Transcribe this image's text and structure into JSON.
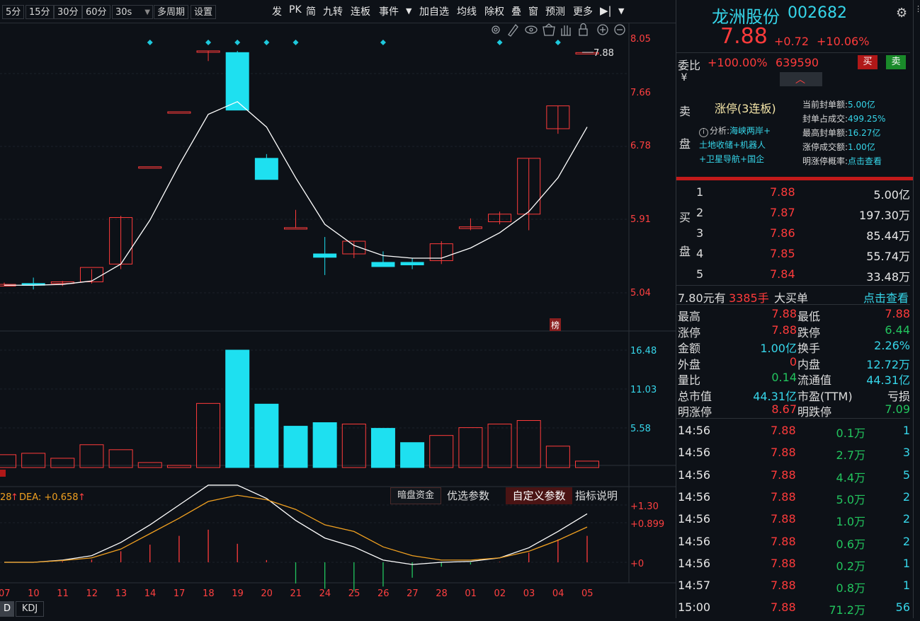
{
  "toolbar": {
    "periods": [
      "5分",
      "15分",
      "30分",
      "60分",
      "30s"
    ],
    "multi_period": "多周期",
    "settings": "设置",
    "right_items": [
      "发",
      "PK",
      "简",
      "九转",
      "连板",
      "事件",
      "加自选",
      "均线",
      "除权",
      "叠",
      "窗",
      "预测",
      "更多"
    ]
  },
  "chart": {
    "price_labels": [
      "8.05",
      "7.66",
      "6.78",
      "5.91",
      "5.04"
    ],
    "last_price_tag": "7.88",
    "bang_label": "榜",
    "volume_labels": [
      "16.48",
      "11.03",
      "5.58"
    ],
    "macd_labels": [
      "+1.30",
      "+0.899",
      "+0"
    ],
    "macd_header_left": "28",
    "macd_dea": "DEA: +0.658",
    "macd_buttons": [
      "暗盘资金",
      "优选参数",
      "自定义参数",
      "指标说明"
    ],
    "indicator_tabs": [
      "D",
      "KDJ"
    ]
  },
  "chart_data": {
    "type": "candlestick",
    "x": [
      "07",
      "10",
      "11",
      "12",
      "13",
      "14",
      "17",
      "18",
      "19",
      "20",
      "21",
      "24",
      "25",
      "26",
      "27",
      "28",
      "01",
      "02",
      "03",
      "04",
      "05"
    ],
    "ohlc": [
      [
        5.12,
        5.16,
        5.12,
        5.14
      ],
      [
        5.15,
        5.22,
        5.08,
        5.13
      ],
      [
        5.15,
        5.18,
        5.12,
        5.17
      ],
      [
        5.17,
        5.32,
        5.15,
        5.34
      ],
      [
        5.38,
        5.95,
        5.32,
        5.93
      ],
      [
        6.53,
        6.53,
        6.53,
        6.53
      ],
      [
        7.18,
        7.18,
        7.18,
        7.18
      ],
      [
        7.9,
        7.9,
        7.78,
        7.9
      ],
      [
        7.88,
        7.9,
        7.2,
        7.2
      ],
      [
        6.63,
        6.68,
        6.38,
        6.38
      ],
      [
        5.81,
        6.02,
        5.81,
        5.81
      ],
      [
        5.5,
        5.7,
        5.25,
        5.46
      ],
      [
        5.5,
        5.65,
        5.45,
        5.65
      ],
      [
        5.4,
        5.53,
        5.35,
        5.35
      ],
      [
        5.4,
        5.45,
        5.32,
        5.37
      ],
      [
        5.42,
        5.65,
        5.38,
        5.62
      ],
      [
        5.8,
        5.92,
        5.78,
        5.82
      ],
      [
        5.88,
        6.0,
        5.85,
        5.97
      ],
      [
        5.97,
        6.63,
        5.78,
        6.63
      ],
      [
        6.98,
        7.25,
        6.92,
        7.25
      ],
      [
        7.88,
        7.88,
        7.88,
        7.88
      ]
    ],
    "up_colors": {
      "up": "#ff3b3b",
      "down": "#1ee0f0"
    },
    "ma": [
      5.13,
      5.13,
      5.14,
      5.18,
      5.38,
      5.9,
      6.55,
      7.15,
      7.3,
      7.0,
      6.4,
      5.85,
      5.6,
      5.48,
      5.45,
      5.45,
      5.57,
      5.75,
      6.0,
      6.4,
      7.0
    ],
    "volume": [
      1.8,
      2.0,
      1.3,
      3.2,
      2.5,
      0.7,
      0.3,
      9.0,
      16.48,
      8.9,
      5.8,
      6.3,
      6.1,
      5.5,
      3.5,
      4.5,
      5.6,
      6.1,
      6.6,
      3.0,
      0.9
    ],
    "volume_up": [
      true,
      true,
      true,
      true,
      true,
      true,
      true,
      true,
      false,
      false,
      false,
      false,
      true,
      false,
      false,
      true,
      true,
      true,
      true,
      true,
      true
    ],
    "macd_dif": [
      0.0,
      0.0,
      0.05,
      0.15,
      0.45,
      0.85,
      1.3,
      1.75,
      1.75,
      1.45,
      0.95,
      0.55,
      0.35,
      0.05,
      -0.05,
      0.0,
      0.02,
      0.1,
      0.33,
      0.7,
      1.1
    ],
    "macd_dea": [
      0.0,
      0.0,
      0.04,
      0.1,
      0.3,
      0.65,
      1.0,
      1.38,
      1.52,
      1.42,
      1.2,
      0.85,
      0.7,
      0.35,
      0.15,
      0.05,
      0.05,
      0.1,
      0.25,
      0.5,
      0.8
    ],
    "macd_hist": [
      0.0,
      0.0,
      0.02,
      0.06,
      0.25,
      0.4,
      0.6,
      0.74,
      0.42,
      0.05,
      -0.48,
      -0.6,
      -0.65,
      -0.55,
      -0.35,
      -0.1,
      -0.05,
      0.01,
      0.22,
      0.52,
      0.6
    ],
    "ylim_price": [
      5.04,
      8.05
    ],
    "ylim_volume": [
      0,
      16.48
    ],
    "ylim_macd": [
      -0.6,
      1.3
    ]
  },
  "stock": {
    "name": "龙洲股份",
    "code": "002682",
    "price": "7.88",
    "change": "+0.72",
    "pct": "+10.06%",
    "weibi_label": "委比",
    "weibi": "+100.00%",
    "weicha": "639590",
    "buy_btn": "买",
    "sell_btn": "卖",
    "yen": "¥",
    "sell_side": [
      "卖",
      "盘"
    ],
    "limit_title": "涨停(3连板)",
    "analysis_prefix": "分析:",
    "analysis_lines": [
      "海峡两岸+",
      "土地收储+机器人",
      "+卫星导航+国企"
    ],
    "limit_stats": [
      {
        "label": "当前封单额:",
        "value": "5.00亿"
      },
      {
        "label": "封单占成交:",
        "value": "499.25%"
      },
      {
        "label": "最高封单额:",
        "value": "16.27亿"
      },
      {
        "label": "涨停成交额:",
        "value": "1.00亿"
      },
      {
        "label": "明涨停概率:",
        "value": "点击查看"
      }
    ],
    "buy_side": [
      "买",
      "盘"
    ],
    "bids": [
      {
        "lv": "1",
        "price": "7.88",
        "vol": "5.00亿"
      },
      {
        "lv": "2",
        "price": "7.87",
        "vol": "197.30万"
      },
      {
        "lv": "3",
        "price": "7.86",
        "vol": "85.44万"
      },
      {
        "lv": "4",
        "price": "7.85",
        "vol": "55.74万"
      },
      {
        "lv": "5",
        "price": "7.84",
        "vol": "33.48万"
      }
    ],
    "big_order": {
      "price": "7.80元有",
      "qty": "3385手",
      "label": "大买单",
      "link": "点击查看"
    },
    "stats": [
      {
        "l1": "最高",
        "v1": "7.88",
        "c1": "red",
        "l2": "最低",
        "v2": "7.88",
        "c2": "red"
      },
      {
        "l1": "涨停",
        "v1": "7.88",
        "c1": "red",
        "l2": "跌停",
        "v2": "6.44",
        "c2": "green"
      },
      {
        "l1": "金额",
        "v1": "1.00亿",
        "c1": "cyan",
        "l2": "换手",
        "v2": "2.26%",
        "c2": "cyan"
      },
      {
        "l1": "外盘",
        "v1": "0",
        "c1": "red",
        "l2": "内盘",
        "v2": "12.72万",
        "c2": "cyan"
      },
      {
        "l1": "量比",
        "v1": "0.14",
        "c1": "green",
        "l2": "流通值",
        "v2": "44.31亿",
        "c2": "cyan"
      },
      {
        "l1": "总市值",
        "v1": "44.31亿",
        "c1": "cyan",
        "l2": "市盈(TTM)",
        "v2": "亏损",
        "c2": "white"
      },
      {
        "l1": "明涨停",
        "v1": "8.67",
        "c1": "red",
        "l2": "明跌停",
        "v2": "7.09",
        "c2": "green"
      }
    ],
    "ticks": [
      {
        "t": "14:56",
        "p": "7.88",
        "v": "0.1万",
        "n": "1"
      },
      {
        "t": "14:56",
        "p": "7.88",
        "v": "2.7万",
        "n": "3"
      },
      {
        "t": "14:56",
        "p": "7.88",
        "v": "4.4万",
        "n": "5"
      },
      {
        "t": "14:56",
        "p": "7.88",
        "v": "5.0万",
        "n": "2"
      },
      {
        "t": "14:56",
        "p": "7.88",
        "v": "1.0万",
        "n": "2"
      },
      {
        "t": "14:56",
        "p": "7.88",
        "v": "0.6万",
        "n": "2"
      },
      {
        "t": "14:56",
        "p": "7.88",
        "v": "0.2万",
        "n": "1"
      },
      {
        "t": "14:57",
        "p": "7.88",
        "v": "0.8万",
        "n": "1"
      },
      {
        "t": "15:00",
        "p": "7.88",
        "v": "71.2万",
        "n": "56"
      }
    ]
  }
}
